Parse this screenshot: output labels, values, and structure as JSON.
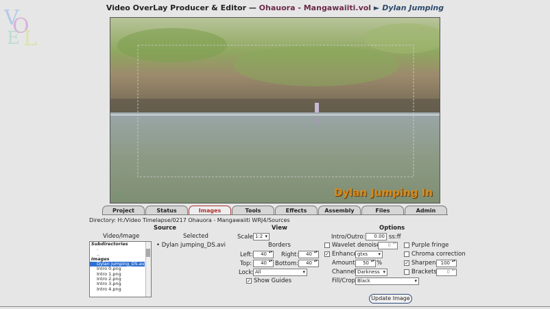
{
  "header": {
    "app_title": "Video OverLay Producer & Editor —",
    "project": "Ohauora - Mangawaiiti.vol",
    "separator": "►",
    "clip": "Dylan Jumping"
  },
  "viewer": {
    "overlay_text": "Dylan Jumping In"
  },
  "tabs": [
    {
      "label": "Project"
    },
    {
      "label": "Status"
    },
    {
      "label": "Images"
    },
    {
      "label": "Tools"
    },
    {
      "label": "Effects"
    },
    {
      "label": "Assembly"
    },
    {
      "label": "Files"
    },
    {
      "label": "Admin"
    }
  ],
  "active_tab": "Images",
  "directory": "Directory: H:/Video Timelapse/0217 Ohauora - Mangawaiiti WRJ4/Sources",
  "source": {
    "heading": "Source",
    "video_image_label": "Video/Image",
    "selected_label": "Selected",
    "selected_item": "• Dylan jumping_DS.avi",
    "list": {
      "subdirectories_label": "Subdirectories",
      "subdirectories": [
        ".",
        ".."
      ],
      "images_label": "Images",
      "images": [
        "Dylan jumping_DS.avi",
        "Intro 0.png",
        "Intro 1.png",
        "Intro 2.png",
        "Intro 3.png",
        "Intro 4.png"
      ],
      "selected": "Dylan jumping_DS.avi"
    }
  },
  "view": {
    "heading": "View",
    "scale_label": "Scale:",
    "scale_value": "1:2",
    "borders_heading": "Borders",
    "left_label": "Left:",
    "left_value": "40",
    "right_label": "Right:",
    "right_value": "40",
    "top_label": "Top:",
    "top_value": "40",
    "bottom_label": "Bottom:",
    "bottom_value": "40",
    "lock_label": "Lock:",
    "lock_value": "All",
    "show_guides_label": "Show Guides",
    "show_guides_checked": true
  },
  "options": {
    "heading": "Options",
    "intro_outro_label": "Intro/Outro:",
    "intro_outro_value": "0.00",
    "intro_outro_unit": "ss:ff",
    "wavelet_label": "Wavelet denoise:",
    "wavelet_value": "0",
    "wavelet_checked": false,
    "enhance_label": "Enhance",
    "enhance_value": "gtxs",
    "enhance_checked": true,
    "amount_label": "Amount:",
    "amount_value": "50",
    "amount_unit": "%",
    "channel_label": "Channel:",
    "channel_value": "Darkness",
    "fill_label": "Fill/Crop:",
    "fill_value": "Black",
    "purple_fringe_label": "Purple fringe",
    "purple_fringe_checked": false,
    "chroma_label": "Chroma correction",
    "chroma_checked": false,
    "sharpen_label": "Sharpen:",
    "sharpen_value": "100",
    "sharpen_checked": true,
    "brackets_label": "Brackets:",
    "brackets_value": "0",
    "brackets_checked": false
  },
  "update_button": "Update Image"
}
